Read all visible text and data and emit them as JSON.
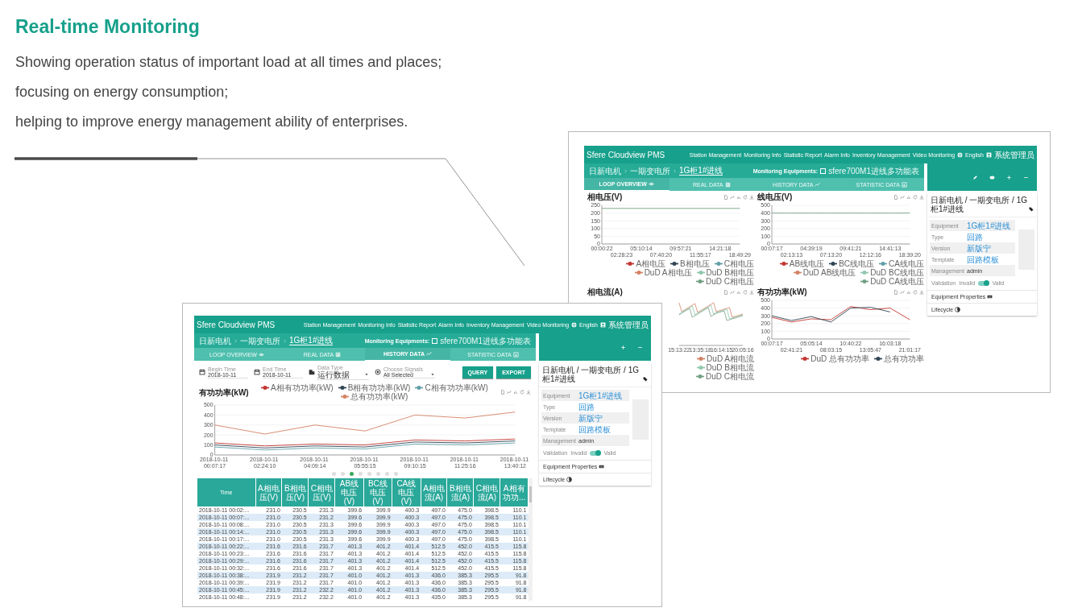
{
  "heading": "Real-time Monitoring",
  "intro": [
    "Showing operation status of important load at all times and places;",
    "focusing on energy consumption;",
    "helping to improve energy management ability of enterprises."
  ],
  "screens": [
    {
      "kind": "overview",
      "app": {
        "brand": "Sfere Cloudview PMS",
        "nav": [
          "Station Management",
          "Monitoring Info",
          "Statistic Report",
          "Alarm Info",
          "Inventory Management",
          "Video Monitoring"
        ],
        "language": "English",
        "user": "系统管理员",
        "breadcrumb": [
          "日新电机",
          "一期变电所",
          "1G柜1#进线"
        ],
        "monitoring_label": "Monitoring Equipments:",
        "equipment": {
          "label": "sfere700M1进线多功能表",
          "checked": false
        },
        "tabs": [
          {
            "label": "LOOP OVERVIEW",
            "selected": true
          },
          {
            "label": "REAL DATA",
            "selected": false
          },
          {
            "label": "HISTORY DATA",
            "selected": false
          },
          {
            "label": "STATISTIC DATA",
            "selected": false
          }
        ],
        "panel": {
          "tools": [
            {
              "kind": "edit"
            },
            {
              "kind": "view"
            },
            {
              "kind": "add"
            },
            {
              "kind": "remove"
            }
          ],
          "path": "日新电机 / 一期变电所 / 1G柜1#进线",
          "properties": [
            {
              "label": "Equipment",
              "value": "1G柜1#进线",
              "link": true
            },
            {
              "label": "Type",
              "value": "回路",
              "link": true
            },
            {
              "label": "Version",
              "value": "新版宁",
              "link": true
            },
            {
              "label": "Template",
              "value": "回路模板",
              "link": true
            },
            {
              "label": "Management",
              "value": "admin",
              "link": false
            }
          ],
          "validation": {
            "label": "Validation",
            "off_label": "Invalid",
            "on_label": "Valid",
            "on": true
          },
          "sections": [
            "Equipment Properties",
            "Lifecycle"
          ]
        }
      },
      "charts": [
        {
          "title": "相电压(V)",
          "chart_data": {
            "type": "line",
            "grid": true,
            "categories": [
              "00:00:22",
              "02:28:23",
              "05:10:14",
              "07:40:20",
              "09:57:21",
              "11:55:17",
              "14:21:18",
              "18:49:29"
            ],
            "ylim": [
              0,
              250
            ],
            "yticks": [
              0,
              50,
              100,
              150,
              200,
              250
            ],
            "series": [
              {
                "name": "A相电压",
                "color": "#c23531",
                "values": [
                  null,
                  null,
                  null,
                  null,
                  null,
                  null,
                  null,
                  null
                ]
              },
              {
                "name": "B相电压",
                "color": "#2f4554",
                "values": [
                  null,
                  null,
                  null,
                  null,
                  null,
                  null,
                  null,
                  null
                ]
              },
              {
                "name": "C相电压",
                "color": "#61a0a8",
                "values": [
                  null,
                  null,
                  null,
                  null,
                  null,
                  null,
                  null,
                  null
                ]
              },
              {
                "name": "DuD A相电压",
                "color": "#d48265",
                "values": [
                  null,
                  null,
                  null,
                  null,
                  null,
                  null,
                  null,
                  null
                ]
              },
              {
                "name": "DuD B相电压",
                "color": "#91c7ae",
                "values": [
                  null,
                  null,
                  null,
                  null,
                  null,
                  null,
                  null,
                  null
                ]
              },
              {
                "name": "DuD C相电压",
                "color": "#749f83",
                "values": [
                  230,
                  230,
                  230,
                  230,
                  230,
                  230,
                  230,
                  230
                ]
              }
            ]
          }
        },
        {
          "title": "线电压(V)",
          "chart_data": {
            "type": "line",
            "grid": true,
            "categories": [
              "00:07:17",
              "02:13:13",
              "04:39:19",
              "07:13:20",
              "09:41:21",
              "12:12:16",
              "14:41:13",
              "18:39:20"
            ],
            "ylim": [
              0,
              500
            ],
            "yticks": [
              0,
              100,
              200,
              300,
              400,
              500
            ],
            "series": [
              {
                "name": "AB线电压",
                "color": "#c23531",
                "values": [
                  null,
                  null,
                  null,
                  null,
                  null,
                  null,
                  null,
                  null
                ]
              },
              {
                "name": "BC线电压",
                "color": "#2f4554",
                "values": [
                  null,
                  null,
                  null,
                  null,
                  null,
                  null,
                  null,
                  null
                ]
              },
              {
                "name": "CA线电压",
                "color": "#61a0a8",
                "values": [
                  null,
                  null,
                  null,
                  null,
                  null,
                  null,
                  null,
                  null
                ]
              },
              {
                "name": "DuD AB线电压",
                "color": "#d48265",
                "values": [
                  null,
                  null,
                  null,
                  null,
                  null,
                  null,
                  null,
                  null
                ]
              },
              {
                "name": "DuD BC线电压",
                "color": "#91c7ae",
                "values": [
                  null,
                  null,
                  null,
                  null,
                  null,
                  null,
                  null,
                  null
                ]
              },
              {
                "name": "DuD CA线电压",
                "color": "#749f83",
                "values": [
                  400,
                  400,
                  400,
                  400,
                  400,
                  400,
                  400,
                  400
                ]
              }
            ]
          }
        },
        {
          "title": "相电流(A)",
          "x_labels": [
            "15:13:22",
            "13:35:18",
            "16:14:15",
            "20:05:16"
          ],
          "legend": [
            {
              "name": "DuD A相电流",
              "color": "#d48265"
            },
            {
              "name": "DuD B相电流",
              "color": "#91c7ae"
            },
            {
              "name": "DuD C相电流",
              "color": "#749f83"
            }
          ]
        },
        {
          "title": "有功功率(kW)",
          "chart_data": {
            "type": "line",
            "grid": true,
            "categories": [
              "00:07:17",
              "02:41:21",
              "05:05:14",
              "08:03:15",
              "10:40:22",
              "13:05:47",
              "16:03:18",
              "21:01:17"
            ],
            "ylim": [
              0,
              500
            ],
            "yticks": [
              0,
              100,
              200,
              300,
              400,
              500
            ],
            "series": [
              {
                "name": "DuD 总有功功率",
                "color": "#c23531",
                "values": [
                  280,
                  220,
                  260,
                  250,
                  420,
                  380,
                  400,
                  250
                ]
              },
              {
                "name": "总有功功率",
                "color": "#2f4554",
                "values": [
                  300,
                  240,
                  290,
                  220,
                  400,
                  410,
                  350,
                  null
                ]
              }
            ]
          }
        }
      ]
    },
    {
      "kind": "history",
      "app": {
        "brand": "Sfere Cloudview PMS",
        "nav": [
          "Station Management",
          "Monitoring Info",
          "Statistic Report",
          "Alarm Info",
          "Inventory Management",
          "Video Monitoring"
        ],
        "language": "English",
        "user": "系统管理员",
        "breadcrumb": [
          "日新电机",
          "一期变电所",
          "1G柜1#进线"
        ],
        "monitoring_label": "Monitoring Equipments:",
        "equipment": {
          "label": "sfere700M1进线多功能表",
          "checked": false
        },
        "tabs": [
          {
            "label": "LOOP OVERVIEW",
            "selected": false
          },
          {
            "label": "REAL DATA",
            "selected": false
          },
          {
            "label": "HISTORY DATA",
            "selected": true
          },
          {
            "label": "STATISTIC DATA",
            "selected": false
          }
        ],
        "panel": {
          "tools": [
            {
              "kind": "add"
            },
            {
              "kind": "remove"
            }
          ],
          "path": "日新电机 / 一期变电所 / 1G柜1#进线",
          "properties": [
            {
              "label": "Equipment",
              "value": "1G柜1#进线",
              "link": true
            },
            {
              "label": "Type",
              "value": "回路",
              "link": true
            },
            {
              "label": "Version",
              "value": "新版宁",
              "link": true
            },
            {
              "label": "Template",
              "value": "回路模板",
              "link": true
            },
            {
              "label": "Management",
              "value": "admin",
              "link": false
            }
          ],
          "validation": {
            "label": "Validation",
            "off_label": "Invalid",
            "on_label": "Valid",
            "on": true
          },
          "sections": [
            "Equipment Properties",
            "Lifecycle"
          ]
        }
      },
      "filters": [
        {
          "kind": "date",
          "label": "Begin Time",
          "value": "2018-10-11"
        },
        {
          "kind": "date",
          "label": "End Time",
          "value": "2018-10-11"
        },
        {
          "kind": "select",
          "label": "Data Type",
          "value": "运行数据"
        },
        {
          "kind": "select",
          "label": "Choose Signals",
          "value": "All Selected"
        }
      ],
      "buttons": [
        "QUERY",
        "EXPORT"
      ],
      "charts": [
        {
          "title": "有功功率(kW)",
          "chart_data": {
            "type": "line",
            "grid": true,
            "categories": [
              "2018-10-11 00:07:17",
              "2018-10-11 02:24:10",
              "2018-10-11 04:09:14",
              "2018-10-11 05:55:15",
              "2018-10-11 09:10:15",
              "2018-10-11 11:25:16",
              "2018-10-11 13:40:12"
            ],
            "ylim": [
              0,
              500
            ],
            "yticks": [
              0,
              100,
              200,
              300,
              400,
              500
            ],
            "series": [
              {
                "name": "A相有功功率(kW)",
                "color": "#c23531",
                "values": [
                  120,
                  90,
                  110,
                  100,
                  150,
                  140,
                  160
                ]
              },
              {
                "name": "B相有功功率(kW)",
                "color": "#2f4554",
                "values": [
                  100,
                  70,
                  90,
                  80,
                  130,
                  120,
                  140
                ]
              },
              {
                "name": "C相有功功率(kW)",
                "color": "#61a0a8",
                "values": [
                  80,
                  50,
                  70,
                  60,
                  110,
                  100,
                  120
                ]
              },
              {
                "name": "总有功功率(kW)",
                "color": "#d48265",
                "values": [
                  300,
                  210,
                  300,
                  240,
                  400,
                  370,
                  430
                ]
              }
            ]
          }
        }
      ],
      "pager": [
        {
          "selected": false
        },
        {
          "selected": false
        },
        {
          "selected": true
        },
        {
          "selected": false
        },
        {
          "selected": false
        },
        {
          "selected": false
        },
        {
          "selected": false
        },
        {
          "selected": false
        }
      ],
      "table": {
        "columns": [
          "Time",
          "A相电压(V)",
          "B相电压(V)",
          "C相电压(V)",
          "AB线电压(V)",
          "BC线电压(V)",
          "CA线电压(V)",
          "A相电流(A)",
          "B相电流(A)",
          "C相电流(A)",
          "A相有功功..."
        ],
        "rows": [
          [
            "2018-10-11 00:02:...",
            "231.0",
            "230.5",
            "231.3",
            "399.6",
            "399.9",
            "400.3",
            "497.0",
            "475.0",
            "398.5",
            "110.1"
          ],
          [
            "2018-10-11 00:07:...",
            "231.0",
            "230.5",
            "231.2",
            "399.6",
            "399.9",
            "400.3",
            "497.0",
            "475.0",
            "398.5",
            "110.1"
          ],
          [
            "2018-10-11 00:08:...",
            "231.0",
            "230.5",
            "231.3",
            "399.6",
            "399.9",
            "400.3",
            "497.0",
            "475.0",
            "398.5",
            "110.1"
          ],
          [
            "2018-10-11 00:14:...",
            "231.0",
            "230.5",
            "231.3",
            "399.6",
            "399.9",
            "400.3",
            "497.0",
            "475.0",
            "398.5",
            "110.1"
          ],
          [
            "2018-10-11 00:17:...",
            "231.0",
            "230.5",
            "231.3",
            "399.6",
            "399.9",
            "400.3",
            "497.0",
            "475.0",
            "398.5",
            "110.1"
          ],
          [
            "2018-10-11 00:22:...",
            "231.6",
            "231.6",
            "231.7",
            "401.3",
            "401.2",
            "401.4",
            "512.5",
            "452.0",
            "415.5",
            "115.8"
          ],
          [
            "2018-10-11 00:23:...",
            "231.6",
            "231.6",
            "231.7",
            "401.3",
            "401.2",
            "401.4",
            "512.5",
            "452.0",
            "415.5",
            "115.8"
          ],
          [
            "2018-10-11 00:29:...",
            "231.6",
            "231.6",
            "231.7",
            "401.3",
            "401.2",
            "401.4",
            "512.5",
            "452.0",
            "415.5",
            "115.8"
          ],
          [
            "2018-10-11 00:32:...",
            "231.6",
            "231.6",
            "231.7",
            "401.3",
            "401.2",
            "401.4",
            "512.5",
            "452.0",
            "415.5",
            "115.8"
          ],
          [
            "2018-10-11 00:38:...",
            "231.9",
            "231.2",
            "231.7",
            "401.0",
            "401.2",
            "401.3",
            "436.0",
            "385.3",
            "295.5",
            "91.8"
          ],
          [
            "2018-10-11 00:39:...",
            "231.9",
            "231.2",
            "231.7",
            "401.0",
            "401.2",
            "401.3",
            "436.0",
            "385.3",
            "295.5",
            "91.8"
          ],
          [
            "2018-10-11 00:45:...",
            "231.9",
            "231.2",
            "232.2",
            "401.0",
            "401.2",
            "401.3",
            "436.0",
            "385.3",
            "295.5",
            "91.8"
          ],
          [
            "2018-10-11 00:48:...",
            "231.9",
            "231.2",
            "232.2",
            "401.0",
            "401.2",
            "401.3",
            "435.0",
            "385.3",
            "295.5",
            "91.8"
          ]
        ]
      }
    }
  ]
}
